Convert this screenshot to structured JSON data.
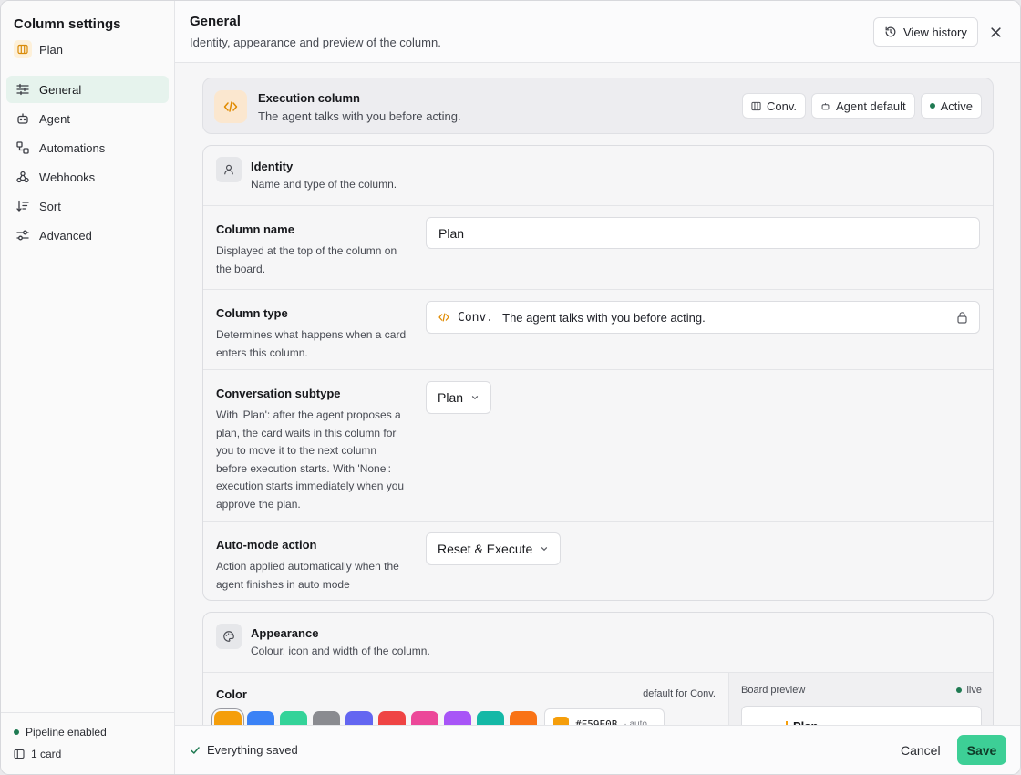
{
  "sidebar": {
    "title": "Column settings",
    "column_name": "Plan",
    "items": [
      {
        "label": "General",
        "icon": "sliders-icon"
      },
      {
        "label": "Agent",
        "icon": "robot-icon"
      },
      {
        "label": "Automations",
        "icon": "workflow-icon"
      },
      {
        "label": "Webhooks",
        "icon": "webhook-icon"
      },
      {
        "label": "Sort",
        "icon": "sort-icon"
      },
      {
        "label": "Advanced",
        "icon": "settings-icon"
      }
    ],
    "active_index": 0,
    "status_pipeline": "Pipeline enabled",
    "card_count": "1 card"
  },
  "header": {
    "title": "General",
    "subtitle": "Identity, appearance and preview of the column.",
    "history_label": "View history"
  },
  "execution": {
    "title": "Execution column",
    "subtitle": "The agent talks with you before acting.",
    "chips": [
      "Conv.",
      "Agent default",
      "Active"
    ]
  },
  "identity": {
    "title": "Identity",
    "subtitle": "Name and type of the column.",
    "name": {
      "label": "Column name",
      "desc": "Displayed at the top of the column on the board.",
      "value": "Plan"
    },
    "type": {
      "label": "Column type",
      "desc": "Determines what happens when a card enters this column.",
      "code": "Conv.",
      "value_desc": "The agent talks with you before acting."
    },
    "subtype": {
      "label": "Conversation subtype",
      "desc": "With 'Plan': after the agent proposes a plan, the card waits in this column for you to move it to the next column before execution starts. With 'None': execution starts immediately when you approve the plan.",
      "value": "Plan"
    },
    "automode": {
      "label": "Auto-mode action",
      "desc": "Action applied automatically when the agent finishes in auto mode",
      "value": "Reset & Execute"
    }
  },
  "appearance": {
    "title": "Appearance",
    "subtitle": "Colour, icon and width of the column.",
    "color_label": "Color",
    "color_hint": "default for Conv.",
    "swatches": [
      "#f59e0b",
      "#3b82f6",
      "#34d399",
      "#8a8b90",
      "#6366f1",
      "#ef4444",
      "#ec4899",
      "#a855f7",
      "#14b8a6",
      "#f97316"
    ],
    "hex": "#F59E0B",
    "hex_auto": "· auto",
    "preview_label": "Board preview",
    "preview_live": "live",
    "preview_name": "Plan"
  },
  "footer": {
    "saved": "Everything saved",
    "cancel": "Cancel",
    "save": "Save"
  },
  "colors": {
    "accent": "#3dcf96",
    "amber": "#f59e0b",
    "status_green": "#1f7a52"
  }
}
